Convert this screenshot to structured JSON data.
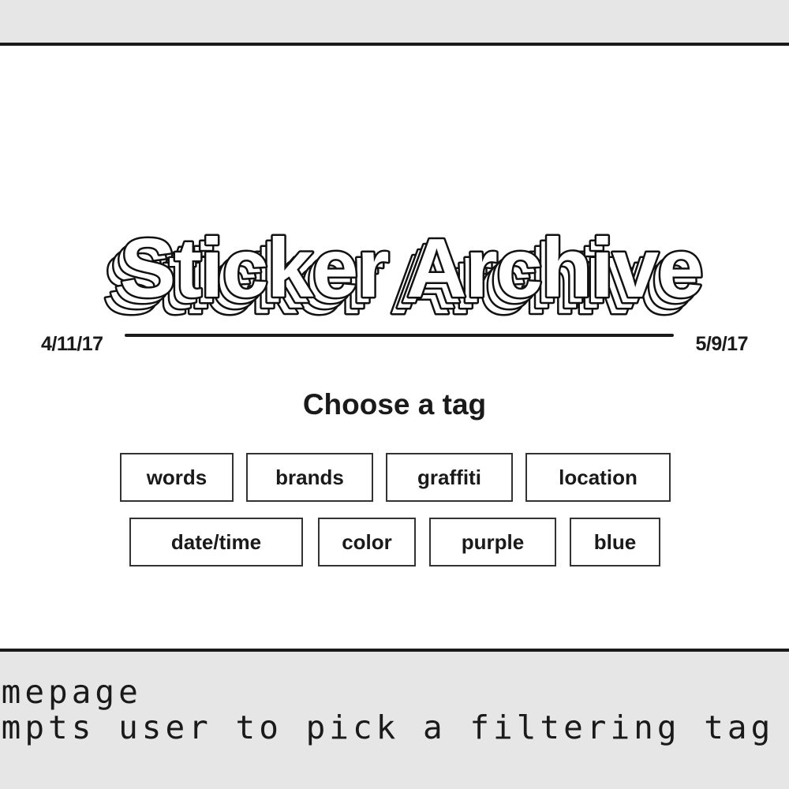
{
  "title": "Sticker Archive",
  "timeline": {
    "start_date": "4/11/17",
    "end_date": "5/9/17"
  },
  "prompt": "Choose a tag",
  "tags": [
    "words",
    "brands",
    "graffiti",
    "location",
    "date/time",
    "color",
    "purple",
    "blue"
  ],
  "annotation": {
    "line1": "omepage",
    "line2": "ompts user to pick a filtering tag"
  },
  "colors": {
    "ink": "#1a1a1a",
    "page_background": "#ffffff",
    "outer_background": "#e6e6e6"
  }
}
